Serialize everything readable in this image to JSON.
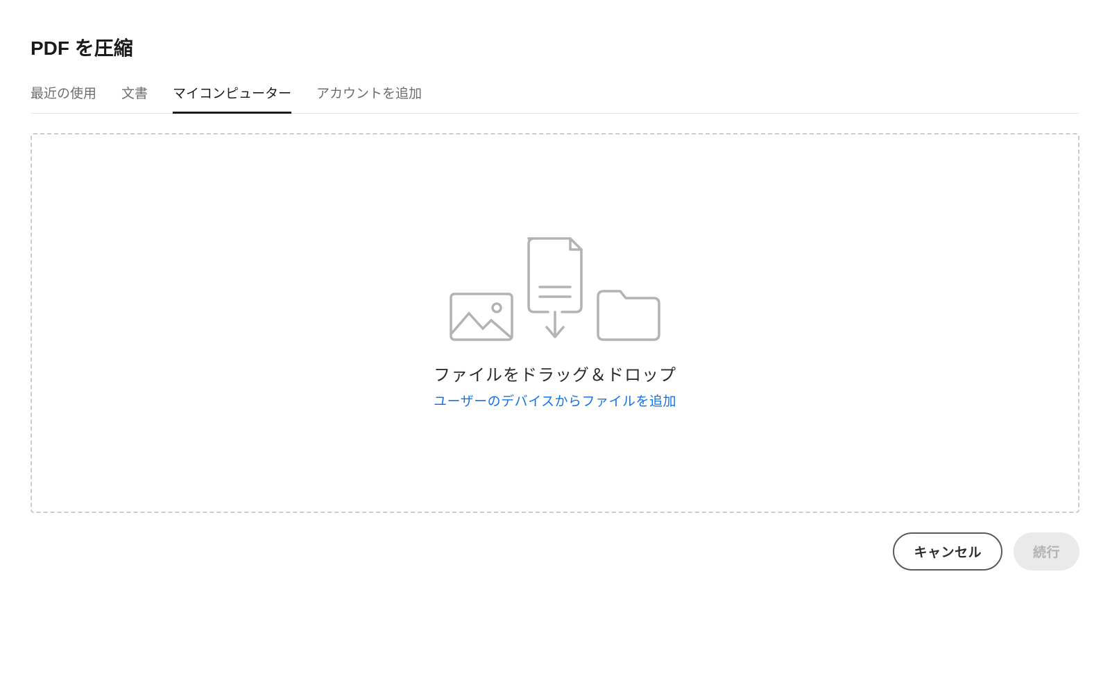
{
  "title": "PDF を圧縮",
  "tabs": {
    "recent": "最近の使用",
    "documents": "文書",
    "my_computer": "マイコンピューター",
    "add_account": "アカウントを追加"
  },
  "dropzone": {
    "heading": "ファイルをドラッグ＆ドロップ",
    "link_text": "ユーザーのデバイスからファイルを追加"
  },
  "footer": {
    "cancel_label": "キャンセル",
    "continue_label": "続行"
  },
  "colors": {
    "link": "#1473e6",
    "text_primary": "#1a1a1a",
    "text_secondary": "#6e6e6e",
    "border_dashed": "#cccccc",
    "disabled_bg": "#eaeaea",
    "disabled_text": "#b3b3b3"
  }
}
